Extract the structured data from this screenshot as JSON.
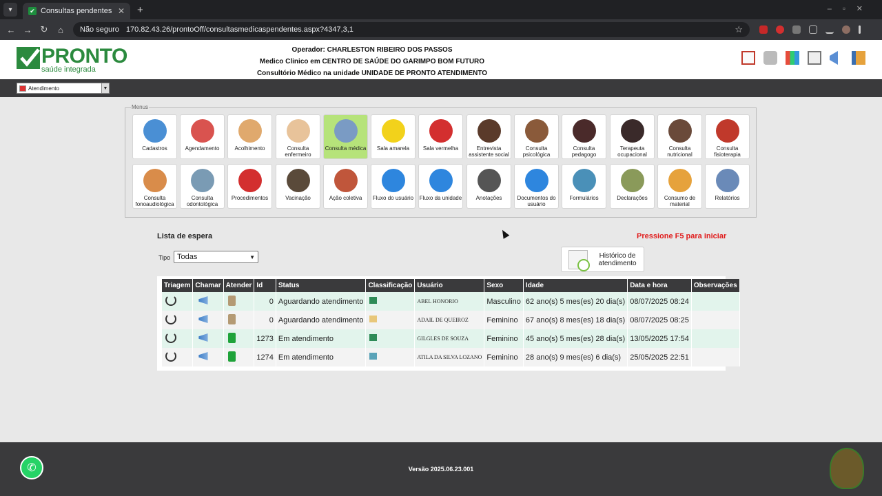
{
  "browser": {
    "tab_title": "Consultas pendentes",
    "not_secure": "Não seguro",
    "url": "170.82.43.26/prontoOff/consultasmedicaspendentes.aspx?4347,3,1"
  },
  "logo": {
    "name": "PRONTO",
    "tagline": "saúde integrada"
  },
  "operator": {
    "line1": "Operador: CHARLESTON RIBEIRO DOS PASSOS",
    "line2": "Medico Clinico em CENTRO DE SAÚDE DO GARIMPO BOM FUTURO",
    "line3": "Consultório Médico na unidade UNIDADE DE PRONTO ATENDIMENTO"
  },
  "module_select": {
    "value": "Atendimento"
  },
  "menus": {
    "legend": "Menus",
    "row1": [
      {
        "label": "Cadastros",
        "color": "#4a8fd4"
      },
      {
        "label": "Agendamento",
        "color": "#d9534f"
      },
      {
        "label": "Acolhimento",
        "color": "#e0a96d"
      },
      {
        "label": "Consulta enfermeiro",
        "color": "#e8c39a"
      },
      {
        "label": "Consulta médica",
        "color": "#7a9bc4"
      },
      {
        "label": "Sala amarela",
        "color": "#f2d21b"
      },
      {
        "label": "Sala vermelha",
        "color": "#d32f2f"
      },
      {
        "label": "Entrevista assistente social",
        "color": "#5a3a2a"
      },
      {
        "label": "Consulta psicológica",
        "color": "#8a5a3a"
      },
      {
        "label": "Consulta pedagogo",
        "color": "#4a2a2a"
      },
      {
        "label": "Terapeuta ocupacional",
        "color": "#3a2a2a"
      },
      {
        "label": "Consulta nutricional",
        "color": "#6a4a3a"
      },
      {
        "label": "Consulta fisioterapia",
        "color": "#c0392b"
      }
    ],
    "row2": [
      {
        "label": "Consulta fonoaudiológica",
        "color": "#d98c4a"
      },
      {
        "label": "Consulta odontológica",
        "color": "#7a9bb4"
      },
      {
        "label": "Procedimentos",
        "color": "#d32f2f"
      },
      {
        "label": "Vacinação",
        "color": "#5a4a3a"
      },
      {
        "label": "Ação coletiva",
        "color": "#c0563b"
      },
      {
        "label": "Fluxo do usuário",
        "color": "#2e86de"
      },
      {
        "label": "Fluxo da unidade",
        "color": "#2e86de"
      },
      {
        "label": "Anotações",
        "color": "#555555"
      },
      {
        "label": "Documentos do usuário",
        "color": "#2e86de"
      },
      {
        "label": "Formulários",
        "color": "#4a90b8"
      },
      {
        "label": "Declarações",
        "color": "#8a9a5a"
      },
      {
        "label": "Consumo de material",
        "color": "#e6a23c"
      },
      {
        "label": "Relatórios",
        "color": "#6a8ab8"
      }
    ]
  },
  "waiting": {
    "title": "Lista de espera",
    "press_f5": "Pressione F5 para iniciar",
    "tipo_label": "Tipo",
    "tipo_value": "Todas",
    "history_btn": "Histórico de atendimento",
    "columns": [
      "Triagem",
      "Chamar",
      "Atender",
      "Id",
      "Status",
      "Classificação",
      "Usuário",
      "Sexo",
      "Idade",
      "Data e hora",
      "Observações"
    ],
    "rows": [
      {
        "id": "0",
        "status": "Aguardando atendimento",
        "class_color": "#2e8b57",
        "user": "ABEL HONORIO",
        "sexo": "Masculino",
        "idade": "62 ano(s) 5 mes(es) 20 dia(s)",
        "data": "08/07/2025 08:24",
        "obs": "",
        "clip": "brown"
      },
      {
        "id": "0",
        "status": "Aguardando atendimento",
        "class_color": "#e8c77a",
        "user": "ADAIL DE QUEIROZ",
        "sexo": "Feminino",
        "idade": "67 ano(s) 8 mes(es) 18 dia(s)",
        "data": "08/07/2025 08:25",
        "obs": "",
        "clip": "brown"
      },
      {
        "id": "1273",
        "status": "Em atendimento",
        "class_color": "#2e8b57",
        "user": "GILGLES DE SOUZA",
        "sexo": "Feminino",
        "idade": "45 ano(s) 5 mes(es) 28 dia(s)",
        "data": "13/05/2025 17:54",
        "obs": "",
        "clip": "green"
      },
      {
        "id": "1274",
        "status": "Em atendimento",
        "class_color": "#5aa3b8",
        "user": "ATILA DA SILVA LOZANO",
        "sexo": "Feminino",
        "idade": "28 ano(s) 9 mes(es) 6 dia(s)",
        "data": "25/05/2025 22:51",
        "obs": "",
        "clip": "green"
      }
    ]
  },
  "footer": {
    "version": "Versão 2025.06.23.001"
  }
}
